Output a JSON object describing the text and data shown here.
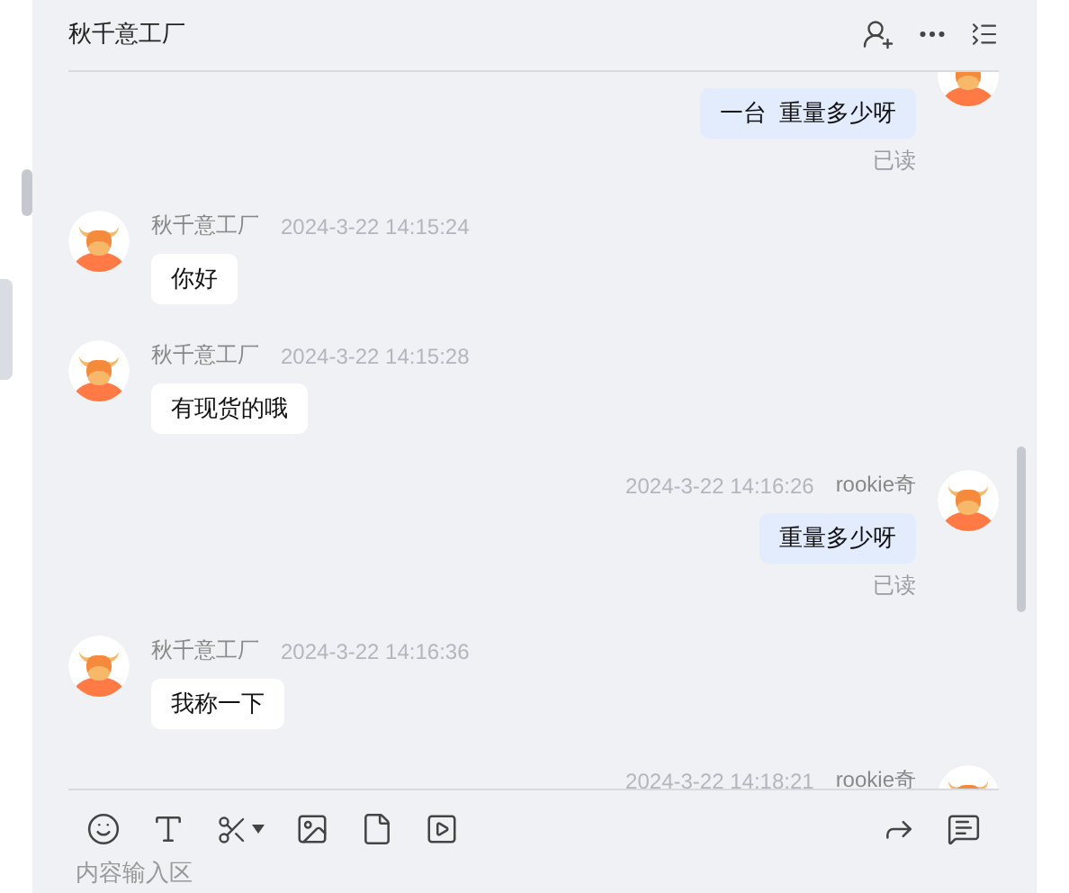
{
  "header": {
    "title": "秋千意工厂"
  },
  "messages": [
    {
      "kind": "outgoing",
      "text": "一台  重量多少呀",
      "status": "已读"
    },
    {
      "kind": "incoming",
      "name": "秋千意工厂",
      "time": "2024-3-22 14:15:24",
      "text": "你好"
    },
    {
      "kind": "incoming",
      "name": "秋千意工厂",
      "time": "2024-3-22 14:15:28",
      "text": "有现货的哦"
    },
    {
      "kind": "outgoing",
      "name": "rookie奇",
      "time": "2024-3-22 14:16:26",
      "text": "重量多少呀",
      "status": "已读"
    },
    {
      "kind": "incoming",
      "name": "秋千意工厂",
      "time": "2024-3-22 14:16:36",
      "text": "我称一下"
    },
    {
      "kind": "outgoing",
      "name": "rookie奇",
      "time": "2024-3-22 14:18:21"
    }
  ],
  "composer": {
    "placeholder": "内容输入区"
  }
}
